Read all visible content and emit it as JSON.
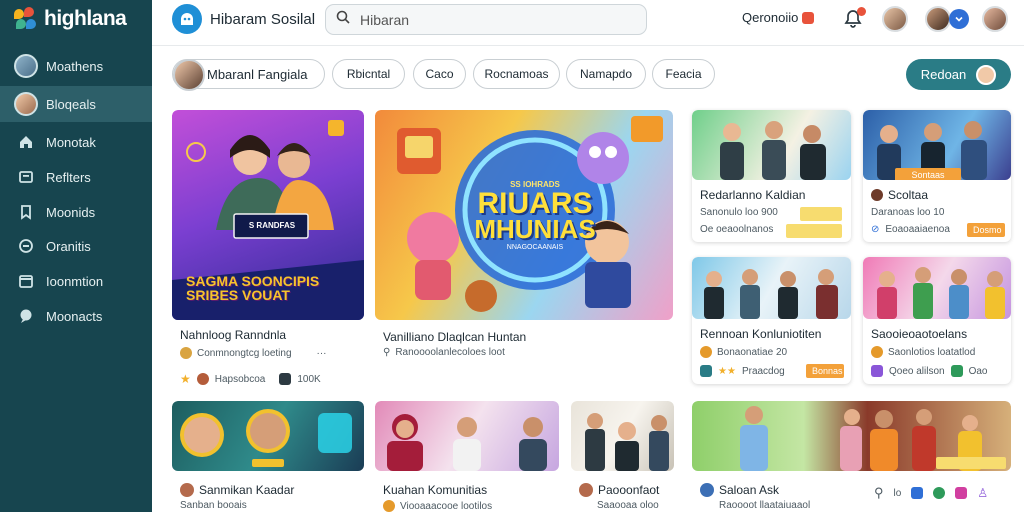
{
  "sidebar": {
    "logo_text": "highlana",
    "items": [
      {
        "label": "Moathens",
        "icon": "avatar"
      },
      {
        "label": "Bloqeals",
        "icon": "avatar-active"
      },
      {
        "label": "Monotak",
        "icon": "home-icon"
      },
      {
        "label": "Reflters",
        "icon": "folder-icon"
      },
      {
        "label": "Moonids",
        "icon": "bookmark-icon"
      },
      {
        "label": "Oranitis",
        "icon": "circle-icon"
      },
      {
        "label": "Ioonmtion",
        "icon": "calendar-icon"
      },
      {
        "label": "Moonacts",
        "icon": "chat-icon"
      }
    ]
  },
  "header": {
    "brand_title": "Hibaram Sosilal",
    "search_placeholder": "Hibaran",
    "link_label": "Qeronoiio",
    "accent": "#2a7c86"
  },
  "chips": {
    "user_label": "Mbaranl Fangiala",
    "items": [
      "Rbicntal",
      "Caco",
      "Rocnamoas",
      "Namapdo",
      "Feacia"
    ],
    "cta_label": "Redoan"
  },
  "cards": {
    "c1": {
      "banner": "SAGMA SOONCIPIS SRIBES VOUAT",
      "sign": "S RANDFAS",
      "title": "Nahnloog Ranndnla",
      "sub": "Conmnongtcg loeting",
      "meta_a": "Hapsobcoa",
      "meta_b": "100K"
    },
    "c2": {
      "headline1": "RIUARS",
      "headline2": "MHUNIAS",
      "ring_top": "SS IOHRADS",
      "ring_bot": "NNAGOCAANAIS",
      "title": "Vanilliano Dlaqlcan Huntan",
      "sub": "Ranoooolanlecoloes loot"
    },
    "c3": {
      "title": "Redarlanno Kaldian",
      "sub": "Sanonulo loo 900",
      "meta": "Oe oeaoolnanos"
    },
    "c4": {
      "title": "Scoltaa",
      "sub": "Daranoas loo 10",
      "meta": "Eoaoaaiaenoa",
      "tag": "Sontaas",
      "badge": "Dosmo"
    },
    "c5": {
      "title": "Rennoan Konluniotiten",
      "sub": "Bonaonatiae 20",
      "meta": "Praacdog",
      "badge": "Bonnas"
    },
    "c6": {
      "title": "Saooieoaotoelans",
      "sub": "Saonlotios loatatlod",
      "meta": "Qoeo alilson",
      "meta_b": "Oao"
    },
    "c7": {
      "title": "Sanmikan Kaadar",
      "sub": "Sanban booais"
    },
    "c8": {
      "title": "Kuahan Komunitias",
      "sub": "Viooaaacooe lootilos"
    },
    "c9": {
      "title": "Paooonfaot",
      "sub": "Saaooaa oloo"
    },
    "c10": {
      "title": "Saloan Ask",
      "sub": "Raoooot llaataiuaaol",
      "icons": "lo"
    }
  }
}
